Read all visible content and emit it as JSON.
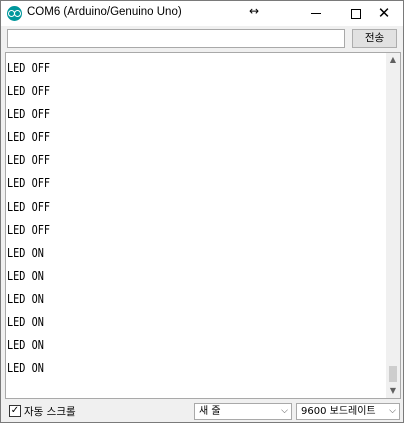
{
  "window": {
    "title": "COM6 (Arduino/Genuino Uno)",
    "resize_symbol": "↔",
    "close_symbol": "✕"
  },
  "send": {
    "input_value": "",
    "button_label": "전송"
  },
  "output": {
    "lines": [
      "LED OFF",
      "LED OFF",
      "LED OFF",
      "LED OFF",
      "LED OFF",
      "LED OFF",
      "LED OFF",
      "LED OFF",
      "LED ON",
      "LED ON",
      "LED ON",
      "LED ON",
      "LED ON",
      "LED ON"
    ]
  },
  "scrollbar": {
    "up_arrow": "▲",
    "down_arrow": "▼"
  },
  "bottom": {
    "autoscroll_checked": true,
    "autoscroll_check": "✓",
    "autoscroll_label": "자동 스크롤",
    "line_ending_selected": "새 줄",
    "baud_selected": "9600 보드레이트",
    "dropdown_chevron": "⌵"
  },
  "colors": {
    "app_icon": "#00979c",
    "window_bg": "#f0f0f0",
    "output_bg": "#ffffff"
  }
}
